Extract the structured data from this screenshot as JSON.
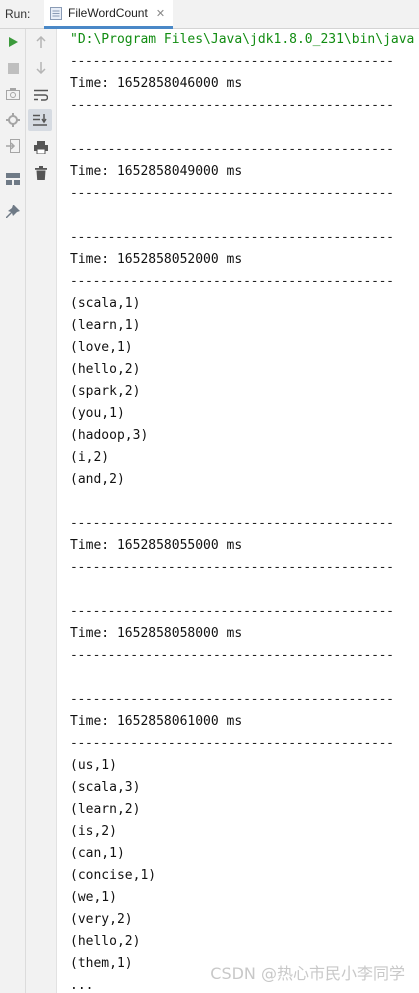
{
  "panel": {
    "run_label": "Run:",
    "tab_label": "FileWordCount",
    "tab_close": "✕"
  },
  "console": {
    "command": "\"D:\\Program Files\\Java\\jdk1.8.0_231\\bin\\java",
    "rule": "-------------------------------------------",
    "blocks": [
      {
        "time": "Time: 1652858046000 ms",
        "rows": []
      },
      {
        "time": "Time: 1652858049000 ms",
        "rows": []
      },
      {
        "time": "Time: 1652858052000 ms",
        "rows": [
          "(scala,1)",
          "(learn,1)",
          "(love,1)",
          "(hello,2)",
          "(spark,2)",
          "(you,1)",
          "(hadoop,3)",
          "(i,2)",
          "(and,2)"
        ]
      },
      {
        "time": "Time: 1652858055000 ms",
        "rows": []
      },
      {
        "time": "Time: 1652858058000 ms",
        "rows": []
      },
      {
        "time": "Time: 1652858061000 ms",
        "rows": [
          "(us,1)",
          "(scala,3)",
          "(learn,2)",
          "(is,2)",
          "(can,1)",
          "(concise,1)",
          "(we,1)",
          "(very,2)",
          "(hello,2)",
          "(them,1)",
          "..."
        ]
      }
    ]
  },
  "icons": {
    "gutter_left": [
      "run-icon",
      "stop-icon",
      "camera-icon",
      "settings-icon",
      "exit-icon",
      "layout-icon",
      "pin-icon"
    ],
    "gutter_right": [
      "up-arrow-icon",
      "down-arrow-icon",
      "soft-wrap-icon",
      "scroll-to-end-icon",
      "print-icon",
      "trash-icon"
    ]
  },
  "colors": {
    "command": "#118c11",
    "run_green": "#3c9a3c",
    "tab_underline": "#4a88c7"
  },
  "watermark": "CSDN @热心市民小李同学"
}
